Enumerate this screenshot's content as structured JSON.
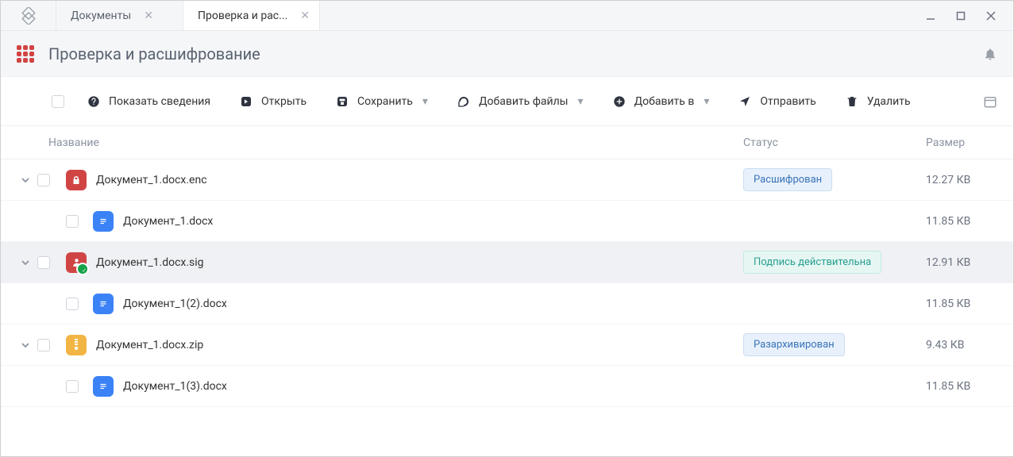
{
  "tabs": [
    {
      "label": "Документы",
      "active": false
    },
    {
      "label": "Проверка и рас...",
      "active": true
    }
  ],
  "page_title": "Проверка и расшифрование",
  "toolbar": {
    "show_details": "Показать сведения",
    "open": "Открыть",
    "save": "Сохранить",
    "add_files": "Добавить файлы",
    "add_to": "Добавить в",
    "send": "Отправить",
    "delete": "Удалить"
  },
  "columns": {
    "name": "Название",
    "status": "Статус",
    "size": "Размер"
  },
  "status_labels": {
    "decrypted": "Расшифрован",
    "valid_signature": "Подпись действительна",
    "unarchived": "Разархивирован"
  },
  "rows": {
    "r0": {
      "name": "Документ_1.docx.enc",
      "size": "12.27 КВ"
    },
    "r0c": {
      "name": "Документ_1.docx",
      "size": "11.85 КВ"
    },
    "r1": {
      "name": "Документ_1.docx.sig",
      "size": "12.91 КВ"
    },
    "r1c": {
      "name": "Документ_1(2).docx",
      "size": "11.85 КВ"
    },
    "r2": {
      "name": "Документ_1.docx.zip",
      "size": "9.43 КВ"
    },
    "r2c": {
      "name": "Документ_1(3).docx",
      "size": "11.85 КВ"
    }
  }
}
